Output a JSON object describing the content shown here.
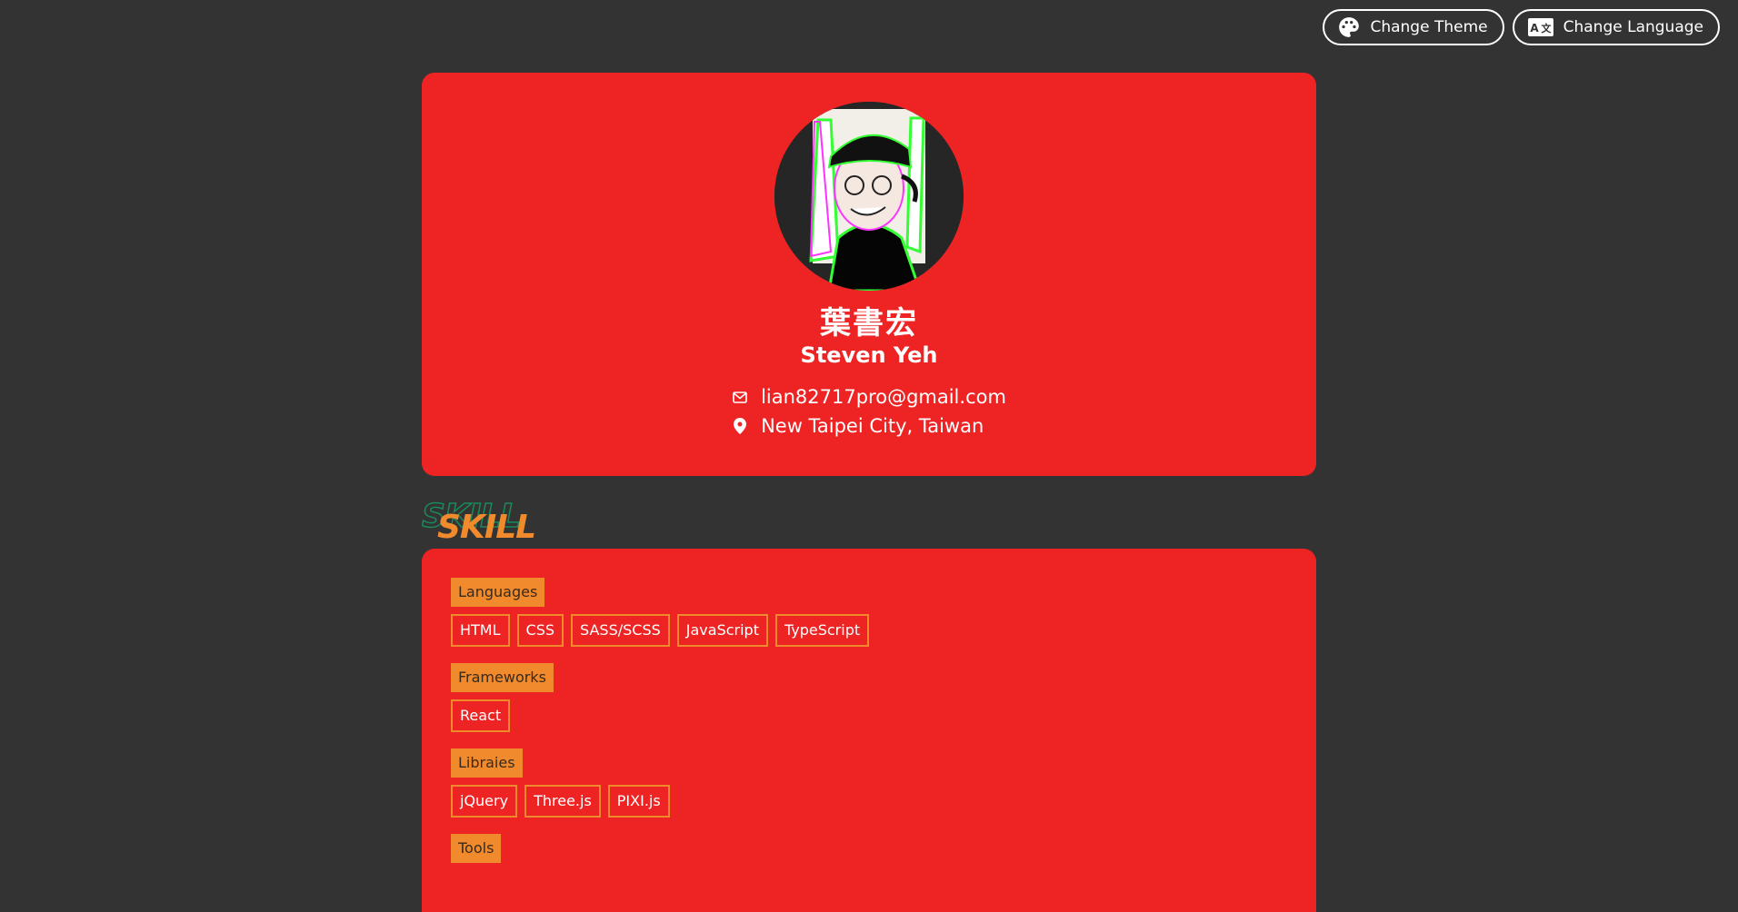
{
  "topbar": {
    "theme_label": "Change Theme",
    "theme_icon": "palette-icon",
    "language_label": "Change Language",
    "language_icon": "translate-icon"
  },
  "profile": {
    "name_zh": "葉書宏",
    "name_en": "Steven Yeh",
    "email": "lian82717pro@gmail.com",
    "email_icon": "envelope-icon",
    "location": "New Taipei City, Taiwan",
    "location_icon": "map-pin-icon"
  },
  "skill_section": {
    "title": "SKILL",
    "groups": [
      {
        "label": "Languages",
        "items": [
          "HTML",
          "CSS",
          "SASS/SCSS",
          "JavaScript",
          "TypeScript"
        ]
      },
      {
        "label": "Frameworks",
        "items": [
          "React"
        ]
      },
      {
        "label": "Libraies",
        "items": [
          "jQuery",
          "Three.js",
          "PIXI.js"
        ]
      },
      {
        "label": "Tools",
        "items": []
      }
    ]
  },
  "colors": {
    "background": "#333333",
    "card": "#ee2323",
    "accent": "#f08a2c",
    "title_outline": "#1a8a5a"
  }
}
